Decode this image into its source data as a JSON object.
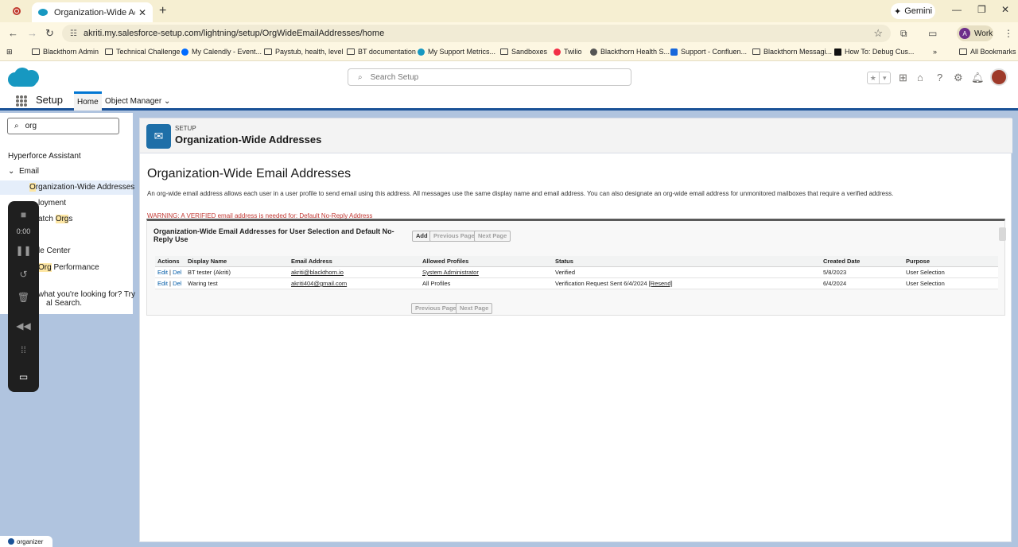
{
  "browser": {
    "tab_title": "Organization-Wide Addresses |",
    "tab_close": "✕",
    "new_tab": "+",
    "gemini_label": "Gemini",
    "url": "akriti.my.salesforce-setup.com/lightning/setup/OrgWideEmailAddresses/home",
    "profile_initial": "A",
    "profile_label": "Work",
    "all_bookmarks": "All Bookmarks",
    "bookmarks": [
      "Blackthorn Admin",
      "Technical Challenge",
      "My Calendly - Event...",
      "Paystub, health, level",
      "BT documentation",
      "My Support Metrics...",
      "Sandboxes",
      "Twilio",
      "Blackthorn Health S...",
      "Support - Confluen...",
      "Blackthorn Messagi...",
      "How To: Debug Cus..."
    ]
  },
  "header": {
    "search_placeholder": "Search Setup",
    "app_name": "Setup",
    "tabs": [
      "Home",
      "Object Manager"
    ]
  },
  "sidebar": {
    "quick_find_value": "org",
    "hyperforce": "Hyperforce Assistant",
    "email_section": "Email",
    "selected_item_hl": "O",
    "selected_item_rest": "rganization-Wide Addresses",
    "item_deployment": "loyment",
    "item_dispatch_pre": "atch ",
    "item_dispatch_hl": "Org",
    "item_dispatch_post": "s",
    "item_center": "le Center",
    "item_perf_hl": "Org",
    "item_perf_post": " Performance",
    "not_found_1": "what you're looking for? Try",
    "not_found_2": "al Search."
  },
  "recorder": {
    "timer": "0:00"
  },
  "page": {
    "eyebrow": "SETUP",
    "title": "Organization-Wide Addresses",
    "heading": "Organization-Wide Email Addresses",
    "description": "An org-wide email address allows each user in a user profile to send email using this address. All messages use the same display name and email address. You can also designate an org-wide email address for unmonitored mailboxes that require a verified address.",
    "warning": "WARNING: A VERIFIED email address is needed for: Default No-Reply Address"
  },
  "related_list": {
    "title": "Organization-Wide Email Addresses for User Selection and Default No-Reply Use",
    "add": "Add",
    "prev": "Previous Page",
    "next": "Next Page",
    "columns": [
      "Actions",
      "Display Name",
      "Email Address",
      "Allowed Profiles",
      "Status",
      "Created Date",
      "Purpose"
    ],
    "edit_label": "Edit",
    "sep": "|",
    "del_label": "Del",
    "rows": [
      {
        "display_name": "BT tester (Akriti)",
        "email": "akriti@blackthorn.io",
        "profiles": "System Administrator",
        "status": "Verified",
        "resend": "",
        "created": "5/8/2023",
        "purpose": "User Selection"
      },
      {
        "display_name": "Waring test",
        "email": "akriti404@gmail.com",
        "profiles": "All Profiles",
        "status": "Verification Request Sent 6/4/2024",
        "resend": "[Resend]",
        "created": "6/4/2024",
        "purpose": "User Selection"
      }
    ]
  },
  "footer": {
    "organizer": "organizer"
  }
}
